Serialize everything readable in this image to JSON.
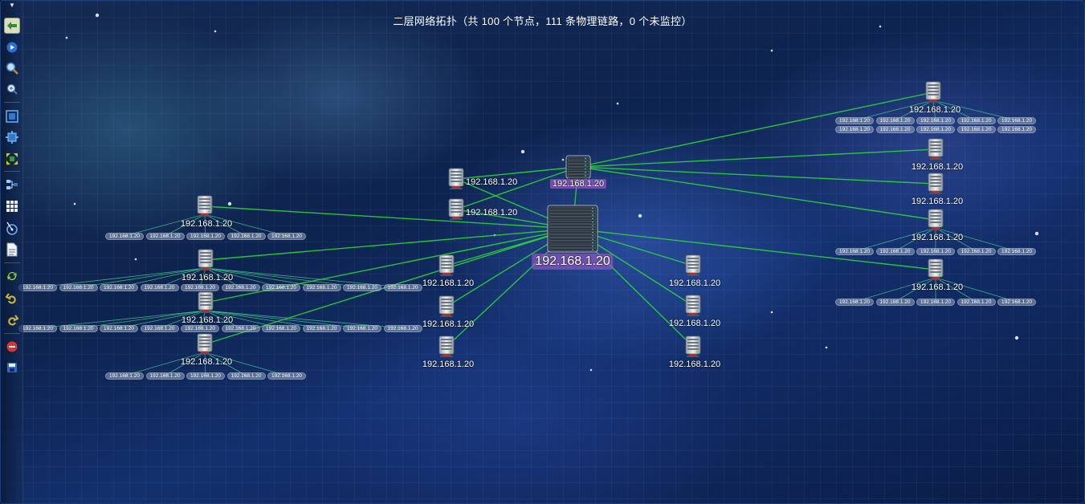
{
  "title": "二层网络拓扑（共 100 个节点，111 条物理链路，0 个未监控）",
  "colors": {
    "link": "#2bd43a",
    "leaf_link": "#3fc08a",
    "selected_label": "#9b5ccf"
  },
  "toolbar": [
    {
      "name": "back-arrow-icon",
      "active": true
    },
    {
      "name": "play-icon"
    },
    {
      "name": "magnifier-icon"
    },
    {
      "name": "zoom-in-icon"
    },
    {
      "name": "fit-window-icon"
    },
    {
      "name": "actual-size-icon"
    },
    {
      "name": "expand-icon"
    },
    {
      "name": "topology-layout-icon"
    },
    {
      "name": "grid-layout-icon"
    },
    {
      "name": "radar-icon"
    },
    {
      "name": "export-document-icon"
    },
    {
      "name": "refresh-icon"
    },
    {
      "name": "undo-icon"
    },
    {
      "name": "redo-icon"
    },
    {
      "name": "stop-icon"
    },
    {
      "name": "save-icon"
    }
  ],
  "nodes": {
    "core": {
      "label": "192.168.1.20"
    },
    "agg": {
      "label": "192.168.1.20"
    },
    "s1": {
      "label": "192.168.1.20"
    },
    "s2": {
      "label": "192.168.1.20"
    },
    "s3": {
      "label": "192.168.1.20"
    },
    "s4": {
      "label": "192.168.1.20"
    },
    "s5": {
      "label": "192.168.1.20"
    },
    "s6": {
      "label": "192.168.1.20"
    },
    "s7": {
      "label": "192.168.1.20"
    },
    "s8": {
      "label": "192.168.1.20"
    },
    "L1": {
      "label": "192.168.1.20"
    },
    "L2": {
      "label": "192.168.1.20"
    },
    "L3": {
      "label": "192.168.1.20"
    },
    "L4": {
      "label": "192.168.1.20"
    },
    "R1": {
      "label": "192.168.1.20"
    },
    "R2": {
      "label": "192.168.1.20"
    },
    "R3": {
      "label": "192.168.1.20"
    },
    "R4": {
      "label": "192.168.1.20"
    },
    "R5": {
      "label": "192.168.1.20"
    }
  },
  "leaf_label": "192.168.1.20",
  "leaf_groups": {
    "L1": 5,
    "L2": 10,
    "L3": 10,
    "L4": 5,
    "R1": 10,
    "R4": 5,
    "R5": 5
  }
}
